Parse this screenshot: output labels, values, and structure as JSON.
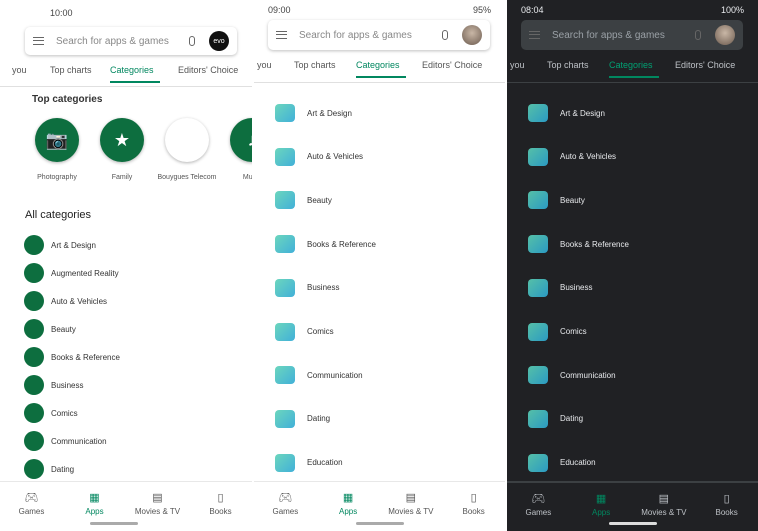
{
  "screens": [
    {
      "status": {
        "time": "10:00",
        "right": ""
      },
      "search": {
        "placeholder": "Search for apps & games",
        "avatar": "evo"
      },
      "tabs": [
        "you",
        "Top charts",
        "Categories",
        "Editors' Choice"
      ],
      "active_tab": "Categories",
      "top_categories": {
        "heading": "Top categories",
        "items": [
          "Photography",
          "Family",
          "Bouygues Telecom",
          "Music"
        ]
      },
      "all_categories": {
        "heading": "All categories",
        "items": [
          "Art & Design",
          "Augmented Reality",
          "Auto & Vehicles",
          "Beauty",
          "Books & Reference",
          "Business",
          "Comics",
          "Communication",
          "Dating"
        ]
      },
      "nav": [
        "Games",
        "Apps",
        "Movies & TV",
        "Books"
      ],
      "active_nav": "Apps"
    },
    {
      "status": {
        "time": "09:00",
        "right": "95%"
      },
      "search": {
        "placeholder": "Search for apps & games"
      },
      "tabs": [
        "you",
        "Top charts",
        "Categories",
        "Editors' Choice"
      ],
      "active_tab": "Categories",
      "categories": [
        "Art & Design",
        "Auto & Vehicles",
        "Beauty",
        "Books & Reference",
        "Business",
        "Comics",
        "Communication",
        "Dating",
        "Education"
      ],
      "nav": [
        "Games",
        "Apps",
        "Movies & TV",
        "Books"
      ],
      "active_nav": "Apps"
    },
    {
      "status": {
        "time": "08:04",
        "right": "100%"
      },
      "search": {
        "placeholder": "Search for apps & games"
      },
      "tabs": [
        "you",
        "Top charts",
        "Categories",
        "Editors' Choice"
      ],
      "active_tab": "Categories",
      "categories": [
        "Art & Design",
        "Auto & Vehicles",
        "Beauty",
        "Books & Reference",
        "Business",
        "Comics",
        "Communication",
        "Dating",
        "Education"
      ],
      "nav": [
        "Games",
        "Apps",
        "Movies & TV",
        "Books"
      ],
      "active_nav": "Apps",
      "theme": "dark"
    }
  ],
  "colors": {
    "accent": "#01875f",
    "dark_bg": "#202124"
  },
  "icons": {
    "nav": [
      "gamepad-icon",
      "apps-grid-icon",
      "film-icon",
      "book-icon"
    ],
    "top": [
      "camera-icon",
      "star-face-icon",
      "bouygues-logo",
      "music-note-icon"
    ]
  }
}
